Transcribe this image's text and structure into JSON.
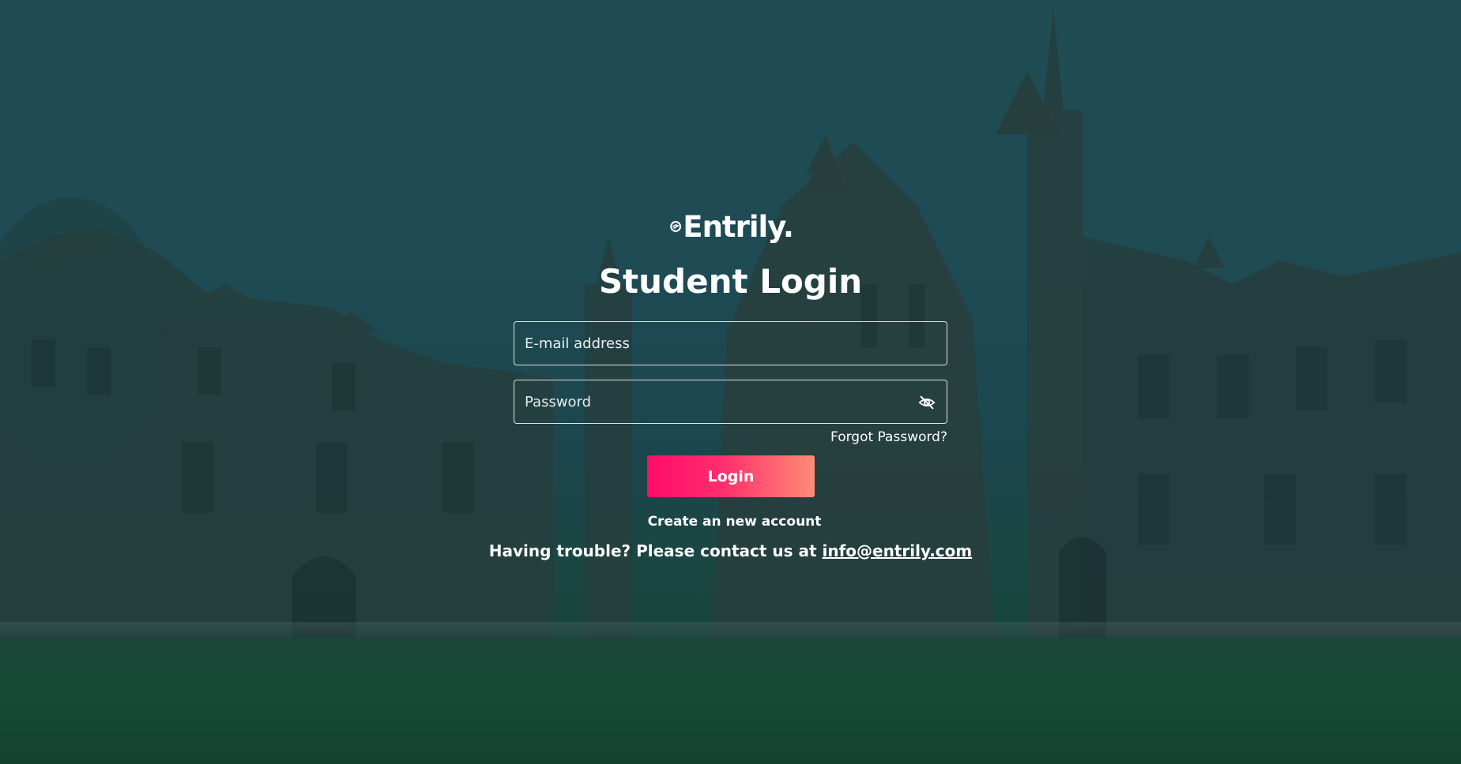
{
  "brand": {
    "name": "Entrily."
  },
  "page": {
    "title": "Student Login"
  },
  "form": {
    "email_placeholder": "E-mail address",
    "email_value": "",
    "password_placeholder": "Password",
    "password_value": "",
    "forgot_label": "Forgot Password?",
    "login_label": "Login",
    "create_account_label": "Create an new account"
  },
  "help": {
    "prefix": "Having trouble? Please contact us at",
    "email": "info@entrily.com"
  },
  "colors": {
    "button_gradient_start": "#ff0b6a",
    "button_gradient_end": "#ff8c76",
    "overlay": "#1f4a4f",
    "text": "#ffffff"
  },
  "icons": {
    "password_toggle": "eye-slash-icon",
    "logo_mark": "entrily-logo-mark"
  }
}
